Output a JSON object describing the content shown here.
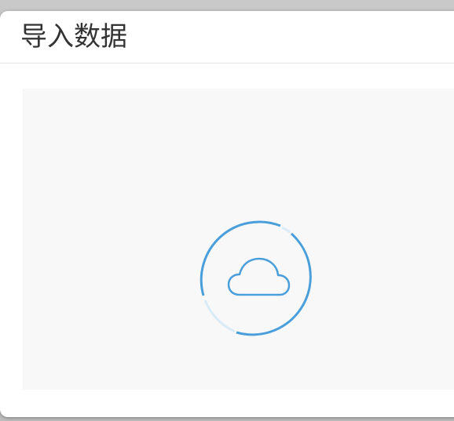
{
  "dialog": {
    "title": "导入数据"
  },
  "upload": {
    "icon": "cloud-upload-icon",
    "spinner_icon": "loading-ring-icon"
  },
  "colors": {
    "accent": "#4a9fdb",
    "zone_background": "#f8f8f9",
    "header_text": "#333333"
  }
}
